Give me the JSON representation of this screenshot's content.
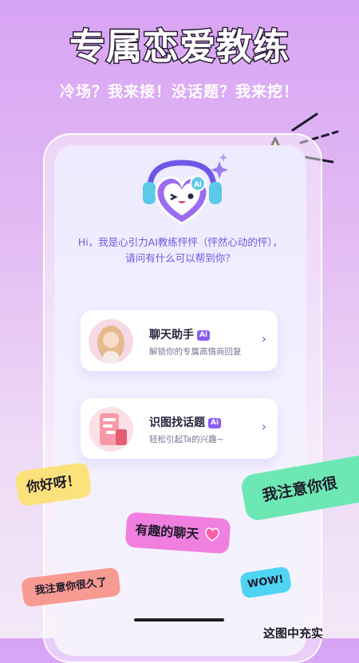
{
  "hero": {
    "title": "专属恋爱教练",
    "subtitle": "冷场？我来接！没话题？我来挖！"
  },
  "assistant": {
    "greeting_line1": "Hi，我是心引力AI教练怦怦（怦然心动的怦），",
    "greeting_line2": "请问有什么可以帮到你？",
    "mascot_badge": "Ai"
  },
  "cards": [
    {
      "title": "聊天助手",
      "badge": "Ai",
      "desc": "解锁你的专属高情商回复",
      "icon": "woman-avatar-icon"
    },
    {
      "title": "识图找话题",
      "badge": "Ai",
      "desc": "轻松引起Ta的兴趣~",
      "icon": "chat-screenshot-icon"
    }
  ],
  "stickers": {
    "hello": "你好呀！",
    "notice_right": "我注意你很",
    "fun_chat": "有趣的聊天",
    "notice_left": "我注意你很久了",
    "wow": "WOW!",
    "bottom_partial": "这图中充实"
  },
  "colors": {
    "accent": "#7a5cf0",
    "bg_top": "#d8a3f4",
    "yellow": "#fbe27a",
    "green": "#6de8b4",
    "pink": "#f07fe0",
    "coral": "#f79a92",
    "cyan": "#4fd4f4"
  }
}
